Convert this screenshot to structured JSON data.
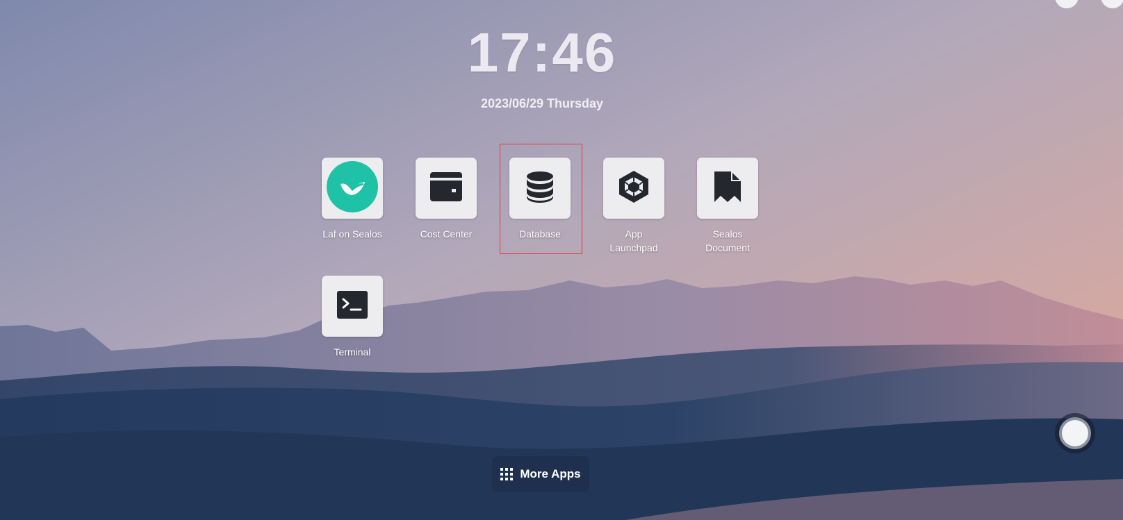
{
  "clock": {
    "time": "17:46",
    "date": "2023/06/29 Thursday"
  },
  "apps": [
    {
      "label": "Laf on Sealos",
      "icon": "laf-logo-icon",
      "accent": "#1fc2a7"
    },
    {
      "label": "Cost Center",
      "icon": "wallet-icon"
    },
    {
      "label": "Database",
      "icon": "database-icon",
      "highlighted": true,
      "highlight_color": "#e23b3b"
    },
    {
      "label": "App Launchpad",
      "icon": "hexagon-gem-icon"
    },
    {
      "label": "Sealos Document",
      "icon": "bookmark-document-icon"
    },
    {
      "label": "Terminal",
      "icon": "terminal-icon"
    }
  ],
  "dock": {
    "more_apps_label": "More Apps",
    "icon": "grid-icon"
  },
  "floating_button": {
    "icon": "assistant-circle-icon"
  },
  "colors": {
    "tile_bg": "#ededf0",
    "icon_dark": "#24272d",
    "label_text": "#ffffff"
  }
}
